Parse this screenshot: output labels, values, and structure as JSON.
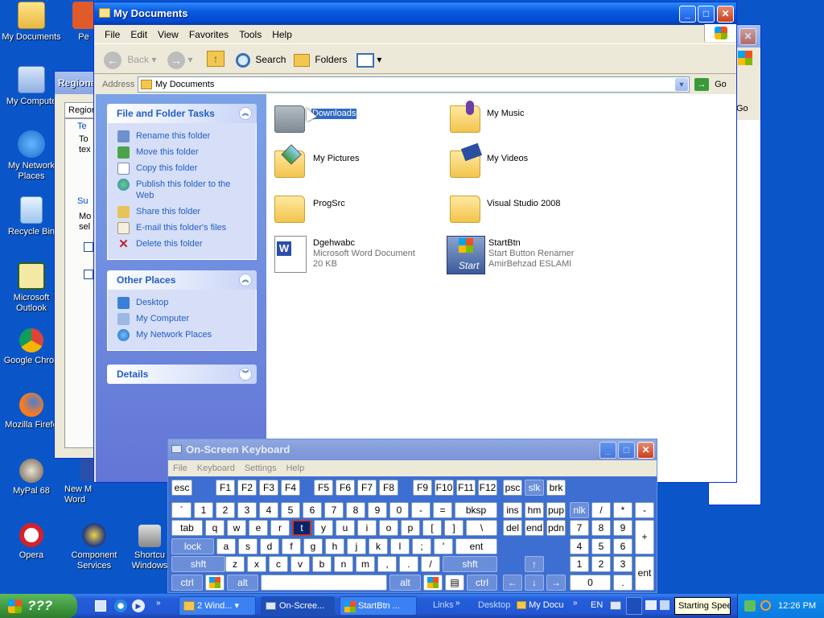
{
  "desktop": {
    "icons": [
      {
        "label": "My Documents"
      },
      {
        "label": "Pe"
      },
      {
        "label": "My Compute"
      },
      {
        "label": "My Network Places"
      },
      {
        "label": "Recycle Bin"
      },
      {
        "label": "Microsoft Outlook"
      },
      {
        "label": "Google Chron"
      },
      {
        "label": "Mozilla Firefo"
      },
      {
        "label": "MyPal 68"
      },
      {
        "label": "New M Word"
      },
      {
        "label": "Opera"
      },
      {
        "label": "Component Services"
      },
      {
        "label": "Shortcu Windows"
      }
    ]
  },
  "bg_window": {
    "title": "Regiona",
    "tab": "Region",
    "group1": "Te",
    "text1": "To",
    "text2": "tex",
    "group2": "Su",
    "text3": "Mo",
    "text4": "sel",
    "go_partial": "Go"
  },
  "explorer": {
    "title": "My Documents",
    "menu": [
      "File",
      "Edit",
      "View",
      "Favorites",
      "Tools",
      "Help"
    ],
    "toolbar": {
      "back": "Back",
      "search": "Search",
      "folders": "Folders"
    },
    "address": {
      "label": "Address",
      "value": "My Documents",
      "go": "Go"
    },
    "tasks": {
      "title": "File and Folder Tasks",
      "links": [
        "Rename this folder",
        "Move this folder",
        "Copy this folder",
        "Publish this folder to the Web",
        "Share this folder",
        "E-mail this folder's files",
        "Delete this folder"
      ]
    },
    "other_places": {
      "title": "Other Places",
      "links": [
        "Desktop",
        "My Computer",
        "My Network Places"
      ]
    },
    "details": {
      "title": "Details"
    },
    "items": [
      {
        "name": "Downloads"
      },
      {
        "name": "My Music"
      },
      {
        "name": "My Pictures"
      },
      {
        "name": "My Videos"
      },
      {
        "name": "ProgSrc"
      },
      {
        "name": "Visual Studio 2008"
      },
      {
        "name": "Dgehwabc",
        "line2": "Microsoft Word Document",
        "line3": "20 KB"
      },
      {
        "name": "StartBtn",
        "line2": "Start Button Renamer",
        "line3": "AmirBehzad ESLAMI",
        "icon_text": "Start"
      }
    ]
  },
  "osk": {
    "title": "On-Screen Keyboard",
    "menu": [
      "File",
      "Keyboard",
      "Settings",
      "Help"
    ],
    "keys": {
      "esc": "esc",
      "f1": "F1",
      "f2": "F2",
      "f3": "F3",
      "f4": "F4",
      "f5": "F5",
      "f6": "F6",
      "f7": "F7",
      "f8": "F8",
      "f9": "F9",
      "f10": "F10",
      "f11": "F11",
      "f12": "F12",
      "psc": "psc",
      "slk": "slk",
      "brk": "brk",
      "grave": "`",
      "d1": "1",
      "d2": "2",
      "d3": "3",
      "d4": "4",
      "d5": "5",
      "d6": "6",
      "d7": "7",
      "d8": "8",
      "d9": "9",
      "d0": "0",
      "minus": "-",
      "equals": "=",
      "bksp": "bksp",
      "ins": "ins",
      "hm": "hm",
      "pup": "pup",
      "nlk": "nlk",
      "npdiv": "/",
      "npmul": "*",
      "npsub": "-",
      "tab": "tab",
      "q": "q",
      "w": "w",
      "e": "e",
      "r": "r",
      "t": "t",
      "y": "y",
      "u": "u",
      "i": "i",
      "o": "o",
      "p": "p",
      "lbr": "[",
      "rbr": "]",
      "bslash": "\\",
      "del": "del",
      "end": "end",
      "pdn": "pdn",
      "np7": "7",
      "np8": "8",
      "np9": "9",
      "npadd": "+",
      "lock": "lock",
      "a": "a",
      "s": "s",
      "d": "d",
      "f": "f",
      "g": "g",
      "h": "h",
      "j": "j",
      "k": "k",
      "l": "l",
      "semi": ";",
      "quote": "'",
      "ent": "ent",
      "np4": "4",
      "np5": "5",
      "np6": "6",
      "shft": "shft",
      "z": "z",
      "x": "x",
      "c": "c",
      "v": "v",
      "b": "b",
      "n": "n",
      "m": "m",
      "comma": ",",
      "period": ".",
      "slash": "/",
      "np1": "1",
      "np2": "2",
      "np3": "3",
      "npent": "ent",
      "ctrl": "ctrl",
      "alt": "alt",
      "np0": "0",
      "npdot": "."
    }
  },
  "taskbar": {
    "start": "???",
    "tasks": [
      "2 Wind...",
      "On-Scree...",
      "StartBtn ...",
      "Links",
      "Desktop",
      "My Docu"
    ],
    "lang": "EN",
    "tooltip": "Starting Spee",
    "clock": "12:26 PM"
  }
}
